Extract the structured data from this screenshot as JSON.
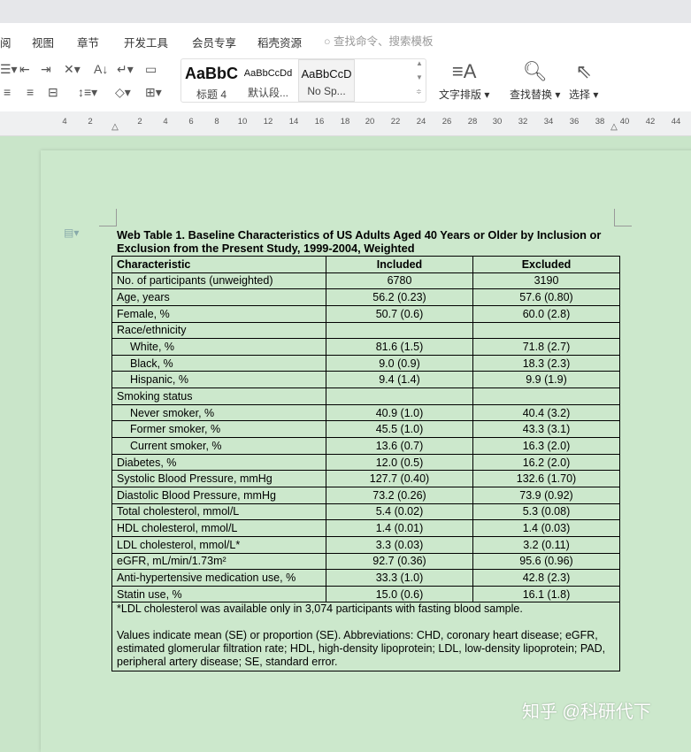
{
  "menu": [
    "阅",
    "视图",
    "章节",
    "开发工具",
    "会员专享",
    "稻壳资源"
  ],
  "search_placeholder": "查找命令、搜索模板",
  "styles": [
    {
      "sample": "AaBbC",
      "label": "标题 4"
    },
    {
      "sample": "AaBbCcDd",
      "label": "默认段..."
    },
    {
      "sample": "AaBbCcD",
      "label": "No Sp..."
    }
  ],
  "big_buttons": {
    "layout": "文字排版",
    "find": "查找替换",
    "select": "选择"
  },
  "ruler": [
    "4",
    "2",
    "2",
    "4",
    "6",
    "8",
    "10",
    "12",
    "14",
    "16",
    "18",
    "20",
    "22",
    "24",
    "26",
    "28",
    "30",
    "32",
    "34",
    "36",
    "38",
    "40",
    "42",
    "44"
  ],
  "doc": {
    "title": "Web Table 1. Baseline Characteristics of US Adults Aged 40 Years or Older by Inclusion or Exclusion from the Present Study, 1999-2004, Weighted",
    "headers": [
      "Characteristic",
      "Included",
      "Excluded"
    ],
    "rows": [
      [
        "No. of participants (unweighted)",
        "6780",
        "3190"
      ],
      [
        "Age, years",
        "56.2 (0.23)",
        "57.6 (0.80)"
      ],
      [
        "Female, %",
        "50.7 (0.6)",
        "60.0 (2.8)"
      ],
      [
        "Race/ethnicity",
        "",
        ""
      ],
      [
        "White, %",
        "81.6 (1.5)",
        "71.8 (2.7)"
      ],
      [
        "Black, %",
        "9.0 (0.9)",
        "18.3 (2.3)"
      ],
      [
        "Hispanic, %",
        "9.4 (1.4)",
        "9.9 (1.9)"
      ],
      [
        "Smoking status",
        "",
        ""
      ],
      [
        "Never smoker, %",
        "40.9 (1.0)",
        "40.4 (3.2)"
      ],
      [
        "Former smoker, %",
        "45.5 (1.0)",
        "43.3 (3.1)"
      ],
      [
        "Current smoker, %",
        "13.6 (0.7)",
        "16.3 (2.0)"
      ],
      [
        "Diabetes, %",
        "12.0 (0.5)",
        "16.2 (2.0)"
      ],
      [
        "Systolic Blood Pressure, mmHg",
        "127.7 (0.40)",
        "132.6 (1.70)"
      ],
      [
        "Diastolic Blood Pressure, mmHg",
        "73.2 (0.26)",
        "73.9 (0.92)"
      ],
      [
        "Total cholesterol, mmol/L",
        "5.4 (0.02)",
        "5.3 (0.08)"
      ],
      [
        "HDL cholesterol, mmol/L",
        "1.4 (0.01)",
        "1.4 (0.03)"
      ],
      [
        "LDL cholesterol, mmol/L*",
        "3.3 (0.03)",
        "3.2 (0.11)"
      ],
      [
        "eGFR, mL/min/1.73m²",
        "92.7 (0.36)",
        "95.6 (0.96)"
      ],
      [
        "Anti-hypertensive medication use, %",
        "33.3 (1.0)",
        "42.8 (2.3)"
      ],
      [
        "Statin use, %",
        "15.0 (0.6)",
        "16.1 (1.8)"
      ]
    ],
    "note1": "*LDL cholesterol was available only in 3,074 participants with fasting blood sample.",
    "note2": "Values indicate mean (SE) or proportion (SE). Abbreviations: CHD, coronary heart disease; eGFR, estimated glomerular filtration rate; HDL, high-density lipoprotein; LDL, low-density lipoprotein; PAD, peripheral artery disease; SE, standard error."
  },
  "watermark": "知乎 @科研代下"
}
